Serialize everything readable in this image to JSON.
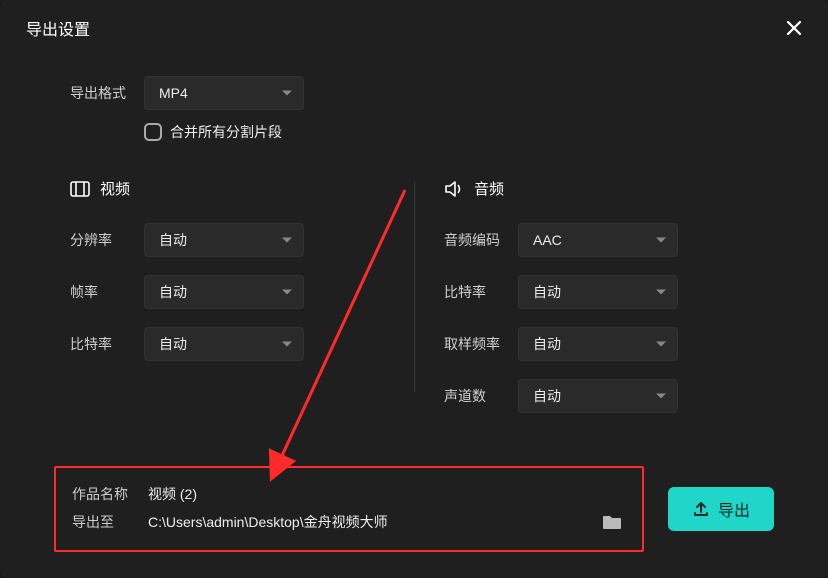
{
  "dialog": {
    "title": "导出设置"
  },
  "format": {
    "label": "导出格式",
    "value": "MP4",
    "merge_label": "合并所有分割片段"
  },
  "video": {
    "header": "视频",
    "resolution_label": "分辨率",
    "resolution_value": "自动",
    "fps_label": "帧率",
    "fps_value": "自动",
    "bitrate_label": "比特率",
    "bitrate_value": "自动"
  },
  "audio": {
    "header": "音频",
    "codec_label": "音频编码",
    "codec_value": "AAC",
    "bitrate_label": "比特率",
    "bitrate_value": "自动",
    "samplerate_label": "取样频率",
    "samplerate_value": "自动",
    "channels_label": "声道数",
    "channels_value": "自动"
  },
  "output": {
    "name_label": "作品名称",
    "name_value": "视频 (2)",
    "path_label": "导出至",
    "path_value": "C:\\Users\\admin\\Desktop\\金舟视频大师"
  },
  "actions": {
    "export": "导出"
  }
}
